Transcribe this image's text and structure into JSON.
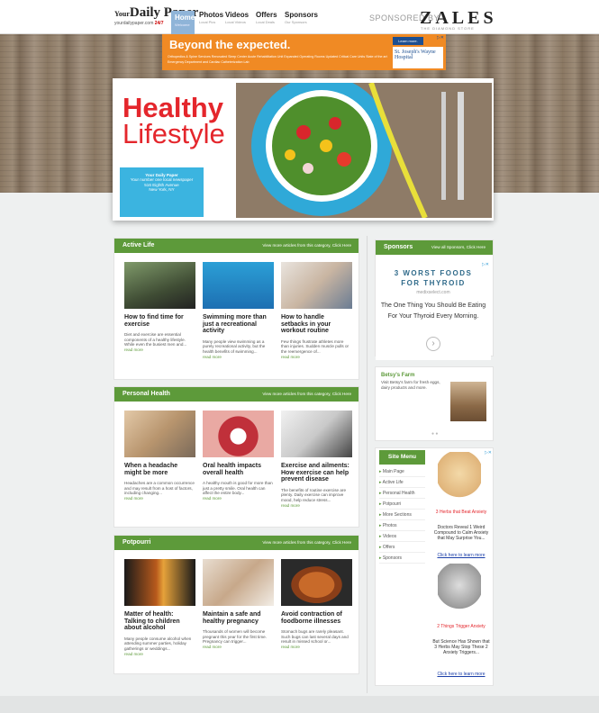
{
  "header": {
    "logo_main": "Daily Paper",
    "logo_prefix": "Your",
    "logo_url": "yourdailypaper.com",
    "logo_badge": "24/7",
    "nav": [
      {
        "label": "Home",
        "sub": "Welcome"
      },
      {
        "label": "Photos",
        "sub": "Local Pics"
      },
      {
        "label": "Videos",
        "sub": "Local Videos"
      },
      {
        "label": "Offers",
        "sub": "Local Deals"
      },
      {
        "label": "Sponsors",
        "sub": "Our Sponsors"
      }
    ],
    "sponsored_by": "SPONSORED BY",
    "sponsor_name": "ZALES",
    "sponsor_tagline": "THE DIAMOND STORE"
  },
  "banner": {
    "title": "Beyond the expected.",
    "services": "Orthopedics & Spine Services  Renovated Sleep Center  Acute Rehabilitation Unit  Expanded Operating Rooms  Updated Critical Care Units  State of the art Emergency Department and Cardiac Catheterization Lab",
    "learn_more": "Learn more.",
    "hospital": "St. Joseph's Wayne Hospital"
  },
  "hero": {
    "title_line1": "Healthy",
    "title_line2": "Lifestyle",
    "info_name": "Your Daily Paper",
    "info_desc": "Your number one local newspaper",
    "info_addr1": "516 Eighth Avenue",
    "info_addr2": "New York, NY"
  },
  "sections": [
    {
      "title": "Active Life",
      "more": "View more articles from this category, Click Here",
      "articles": [
        {
          "title": "How to find time for exercise",
          "excerpt": "Diet and exercise are essential components of a healthy lifestyle. While even the busiest men and...",
          "read_more": "read more"
        },
        {
          "title": "Swimming more than just a recreational activity",
          "excerpt": "Many people view swimming as a purely recreational activity, but the health benefits of swimming...",
          "read_more": "read more"
        },
        {
          "title": "How to handle setbacks in your workout routine",
          "excerpt": "Few things frustrate athletes more than injuries. Sudden muscle pulls or the reemergence of...",
          "read_more": "read more"
        }
      ]
    },
    {
      "title": "Personal Health",
      "more": "View more articles from this category, Click Here",
      "articles": [
        {
          "title": "When a headache might be more",
          "excerpt": "Headaches are a common occurrence and may result from a host of factors, including changing...",
          "read_more": "read more"
        },
        {
          "title": "Oral health impacts overall health",
          "excerpt": "A healthy mouth is good for more than just a pretty smile. Oral health can affect the entire body...",
          "read_more": "read more"
        },
        {
          "title": "Exercise and ailments: How exercise can help prevent disease",
          "excerpt": "The benefits of routine exercise are plenty. Daily exercise can improve mood, help reduce stress...",
          "read_more": "read more"
        }
      ]
    },
    {
      "title": "Potpourri",
      "more": "View more articles from this category, Click Here",
      "articles": [
        {
          "title": "Matter of health: Talking to children about alcohol",
          "excerpt": "Many people consume alcohol when attending summer parties, holiday gatherings or weddings...",
          "read_more": "read more"
        },
        {
          "title": "Maintain a safe and healthy pregnancy",
          "excerpt": "Thousands of women will become pregnant this year for the first time. Pregnancy can trigger...",
          "read_more": "read more"
        },
        {
          "title": "Avoid contraction of foodborne illnesses",
          "excerpt": "Stomach bugs are rarely pleasant. Such bugs can last several days and result in missed school or...",
          "read_more": "read more"
        }
      ]
    }
  ],
  "sidebar": {
    "sponsors_title": "Sponsors",
    "sponsors_more": "View all Sponsors, Click Here",
    "ad_heading1": "3 WORST FOODS",
    "ad_heading2": "FOR THYROID",
    "ad_url": "medixselect.com",
    "ad_body": "The One Thing You Should Be Eating For Your Thyroid Every Morning.",
    "farm_title": "Betsy's Farm",
    "farm_desc": "Visit Betsy's farm for fresh eggs, dairy products and more.",
    "menu_title": "Site Menu",
    "menu_items": [
      "Main Page",
      "Active Life",
      "Personal Health",
      "Potpourri",
      "More Sections",
      "Photos",
      "Videos",
      "Offers",
      "Sponsors"
    ],
    "ad2_red1": "3 Herbs that Beat Anxiety",
    "ad2_body1": "Doctors Reveal 1 Weird Compound to Calm Anxiety that May Surprise You...",
    "ad2_link1": "Click here to learn more",
    "ad2_red2": "2 Things Trigger Anxiety",
    "ad2_body2": "But Science Has Shown that 3 Herbs May Stop These 2 Anxiety Triggers...",
    "ad2_link2": "Click here to learn more"
  },
  "colors": {
    "accent": "#5d9a3a",
    "hero_red": "#e4262c",
    "hero_blue": "#3bb4e0",
    "banner_orange": "#f08a24"
  }
}
